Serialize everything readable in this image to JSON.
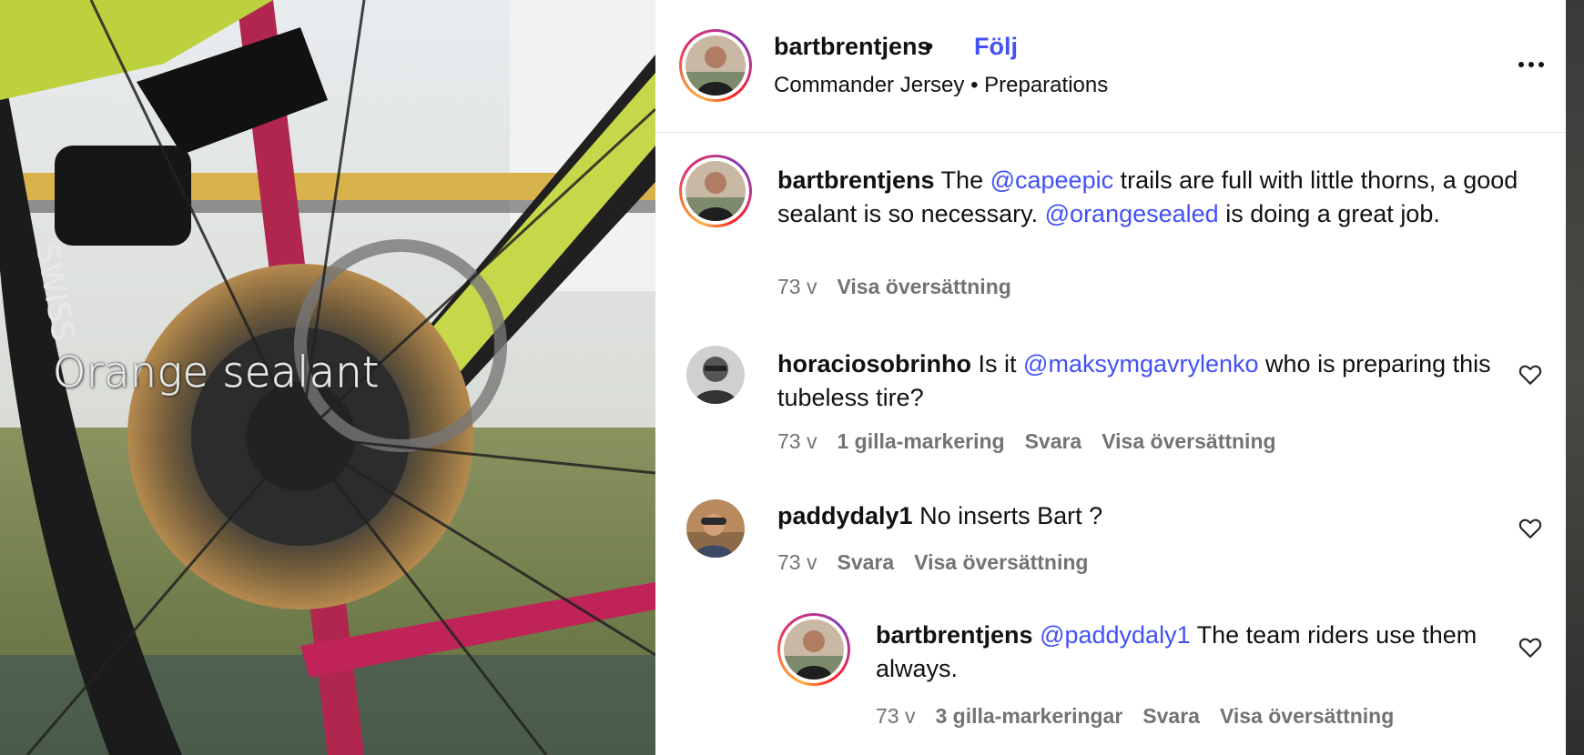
{
  "media": {
    "caption": "Orange sealant"
  },
  "header": {
    "username": "bartbrentjens",
    "separator": "•",
    "follow_label": "Följ",
    "subtitle": "Commander Jersey • Preparations"
  },
  "caption": {
    "username": "bartbrentjens",
    "t1": "The ",
    "m1": "@capeepic",
    "t2": " trails are full with little thorns, a good sealant is so necessary. ",
    "m2": "@orangesealed",
    "t3": " is doing a great job.",
    "time": "73 v",
    "translate": "Visa översättning"
  },
  "comments": [
    {
      "username": "horaciosobrinho",
      "t1": "Is it ",
      "m1": "@maksymgavrylenko",
      "t2": " who is preparing this tubeless tire?",
      "time": "73 v",
      "likes": "1 gilla-markering",
      "reply": "Svara",
      "translate": "Visa översättning"
    },
    {
      "username": "paddydaly1",
      "t1": "No inserts Bart ?",
      "time": "73 v",
      "reply": "Svara",
      "translate": "Visa översättning"
    },
    {
      "username": "bartbrentjens",
      "m1": "@paddydaly1",
      "t1": " The team riders use them always.",
      "time": "73 v",
      "likes": "3 gilla-markeringar",
      "reply": "Svara",
      "translate": "Visa översättning"
    }
  ],
  "colors": {
    "link": "#4150f7",
    "meta": "#737373",
    "text": "#111111"
  },
  "icons": {
    "more": "more-options-icon",
    "like": "heart-icon"
  }
}
